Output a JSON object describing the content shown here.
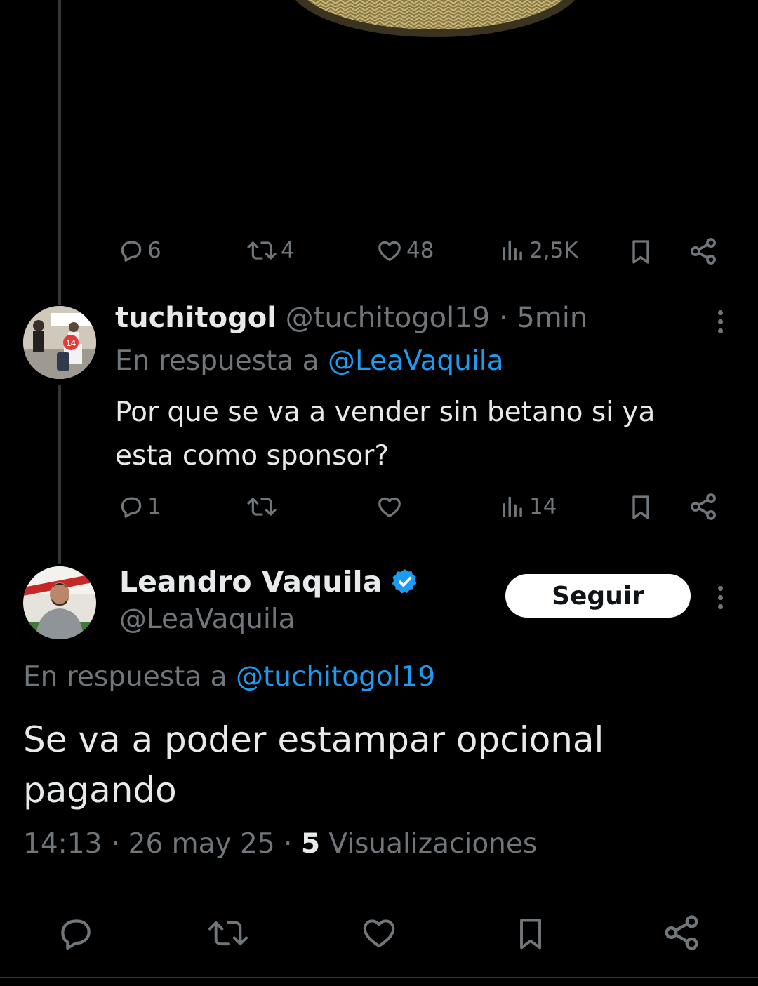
{
  "colors": {
    "background": "#000000",
    "text": "#e7e9ea",
    "muted": "#71767b",
    "accent": "#1d9bf0",
    "verified": "#1d9bf0"
  },
  "parent_tweet": {
    "actions": {
      "reply": {
        "icon": "reply-icon",
        "count": "6"
      },
      "retweet": {
        "icon": "retweet-icon",
        "count": "4"
      },
      "like": {
        "icon": "heart-icon",
        "count": "48"
      },
      "views": {
        "icon": "views-icon",
        "count": "2,5K"
      },
      "bookmark": {
        "icon": "bookmark-icon"
      },
      "share": {
        "icon": "share-icon"
      }
    }
  },
  "reply_tweet": {
    "display_name": "tuchitogol",
    "handle": "@tuchitogol19",
    "separator": "·",
    "time": "5min",
    "in_reply_prefix": "En respuesta a",
    "in_reply_handle": "@LeaVaquila",
    "text_line1": "Por que se va a vender sin betano si ya",
    "text_line2": "esta como sponsor?",
    "actions": {
      "reply": {
        "icon": "reply-icon",
        "count": "1"
      },
      "retweet": {
        "icon": "retweet-icon"
      },
      "like": {
        "icon": "heart-icon"
      },
      "views": {
        "icon": "views-icon",
        "count": "14"
      },
      "bookmark": {
        "icon": "bookmark-icon"
      },
      "share": {
        "icon": "share-icon"
      }
    }
  },
  "main_tweet": {
    "display_name": "Leandro Vaquila",
    "verified_icon": "verified-badge-icon",
    "handle": "@LeaVaquila",
    "follow_label": "Seguir",
    "in_reply_prefix": "En respuesta a",
    "in_reply_handle": "@tuchitogol19",
    "text_line1": "Se va a poder estampar opcional",
    "text_line2": "pagando",
    "time": "14:13",
    "separator": "·",
    "date": "26 may 25",
    "views_count": "5",
    "views_label": "Visualizaciones",
    "bottom_actions": [
      "reply-icon",
      "retweet-icon",
      "heart-icon",
      "bookmark-icon",
      "share-icon"
    ]
  }
}
